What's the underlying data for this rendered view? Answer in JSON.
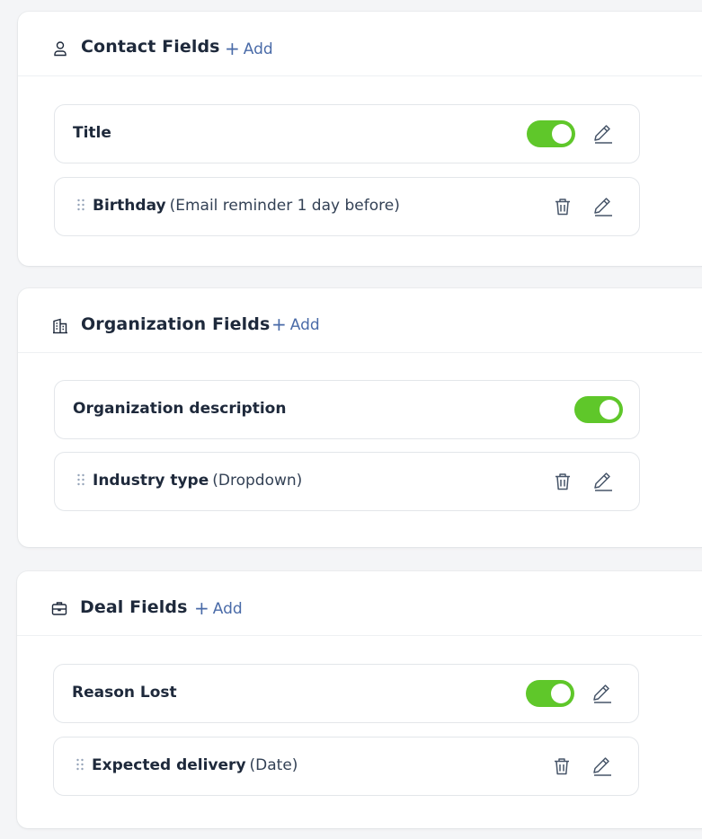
{
  "sections": [
    {
      "title": "Contact Fields",
      "icon": "person-icon",
      "add_label": "Add",
      "fixed_row": {
        "label": "Title",
        "enabled": true
      },
      "custom_row": {
        "label": "Birthday",
        "hint": "(Email reminder 1 day before)"
      }
    },
    {
      "title": "Organization Fields",
      "icon": "building-icon",
      "add_label": "Add",
      "fixed_row": {
        "label": "Organization description",
        "enabled": true
      },
      "custom_row": {
        "label": "Industry type",
        "hint": "(Dropdown)"
      }
    },
    {
      "title": "Deal Fields",
      "icon": "briefcase-icon",
      "add_label": "Add",
      "fixed_row": {
        "label": "Reason Lost",
        "enabled": true
      },
      "custom_row": {
        "label": "Expected delivery",
        "hint": "(Date)"
      }
    }
  ],
  "colors": {
    "toggle_on": "#5fc72a",
    "link": "#4a6ba8",
    "border": "#e3e6ea"
  }
}
